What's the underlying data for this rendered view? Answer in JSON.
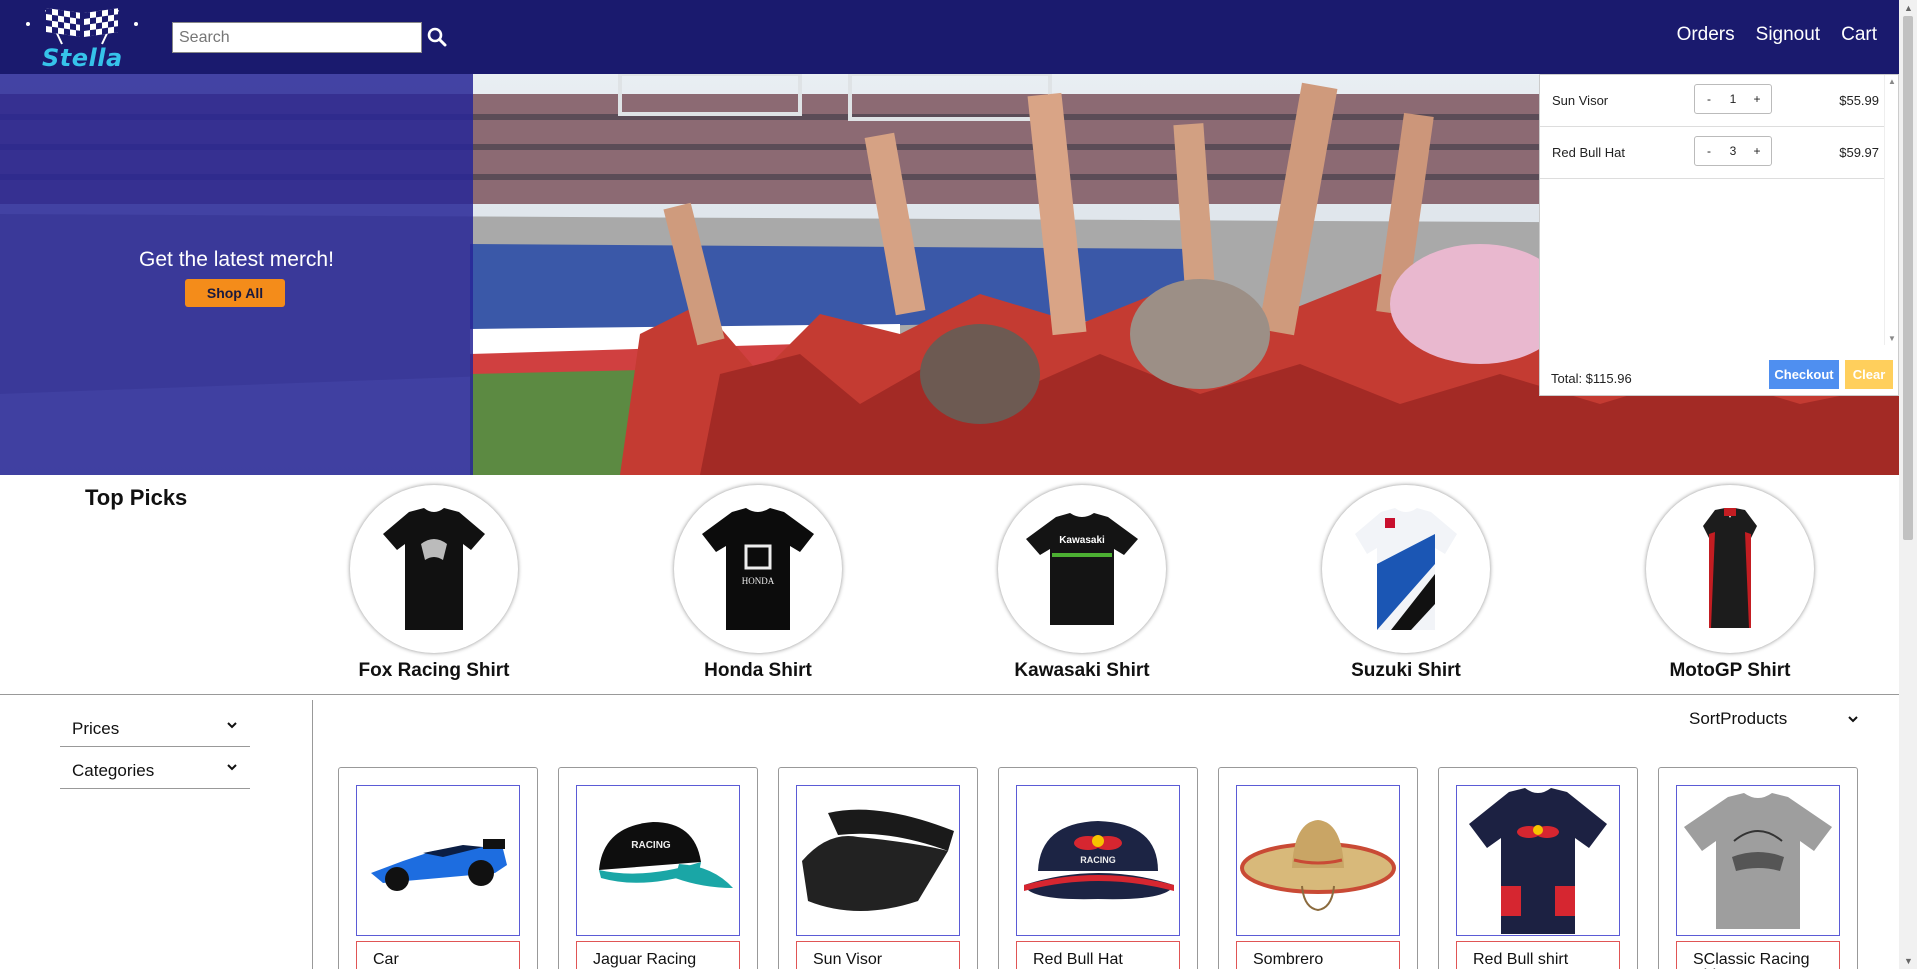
{
  "header": {
    "brand": "Stella",
    "search_placeholder": "Search",
    "nav": {
      "orders": "Orders",
      "signout": "Signout",
      "cart": "Cart"
    }
  },
  "hero": {
    "title": "Get the latest merch!",
    "shop_all": "Shop All"
  },
  "cart": {
    "items": [
      {
        "name": "Sun Visor",
        "qty": "1",
        "price": "$55.99",
        "minus": "-",
        "plus": "+"
      },
      {
        "name": "Red Bull Hat",
        "qty": "3",
        "price": "$59.97",
        "minus": "-",
        "plus": "+"
      }
    ],
    "total": "Total: $115.96",
    "checkout": "Checkout",
    "clear": "Clear"
  },
  "top_picks": {
    "title": "Top Picks",
    "items": [
      {
        "label": "Fox Racing Shirt",
        "icon": "fox-shirt-icon"
      },
      {
        "label": "Honda Shirt",
        "icon": "honda-shirt-icon"
      },
      {
        "label": "Kawasaki Shirt",
        "icon": "kawasaki-shirt-icon"
      },
      {
        "label": "Suzuki Shirt",
        "icon": "suzuki-shirt-icon"
      },
      {
        "label": "MotoGP Shirt",
        "icon": "motogp-shirt-icon"
      }
    ]
  },
  "filters": {
    "prices": "Prices",
    "categories": "Categories",
    "sort": "SortProducts"
  },
  "products": [
    {
      "name": "Car"
    },
    {
      "name": "Jaguar Racing Cap"
    },
    {
      "name": "Sun Visor"
    },
    {
      "name": "Red Bull Hat"
    },
    {
      "name": "Sombrero"
    },
    {
      "name": "Red Bull shirt"
    },
    {
      "name": "SClassic Racing Shirt"
    }
  ],
  "colors": {
    "header_bg": "#1a1a6e",
    "brand_text": "#36c3ea",
    "hero_overlay": "#2826a0",
    "shop_all": "#f48c1a",
    "checkout": "#4f8ff0",
    "clear": "#ffcf5c"
  }
}
